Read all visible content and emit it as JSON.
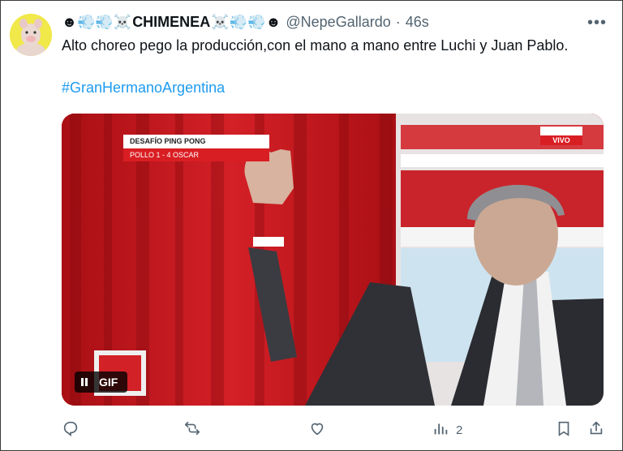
{
  "author": {
    "display_name_prefix": "☻💨💨☠️",
    "display_name": "CHIMENEA",
    "display_name_suffix": "☠️💨💨☻",
    "handle": "@NepeGallardo",
    "separator": "·",
    "time": "46s"
  },
  "tweet": {
    "text": "Alto choreo pego la producción,con el mano a mano entre Luchi y Juan Pablo.",
    "hashtag": "#GranHermanoArgentina"
  },
  "media": {
    "overlay_title": "DESAFÍO PING PONG",
    "overlay_subtitle": "POLLO 1 - 4 OSCAR",
    "live_label": "VIVO",
    "gif_label": "GIF",
    "pause_icon": "pause-icon"
  },
  "actions": {
    "reply_icon": "reply-icon",
    "retweet_icon": "retweet-icon",
    "like_icon": "like-icon",
    "views_icon": "views-icon",
    "views_count": "2",
    "bookmark_icon": "bookmark-icon",
    "share_icon": "share-icon"
  },
  "colors": {
    "link": "#1d9bf0",
    "muted": "#536471",
    "set_red": "#c4151a"
  }
}
